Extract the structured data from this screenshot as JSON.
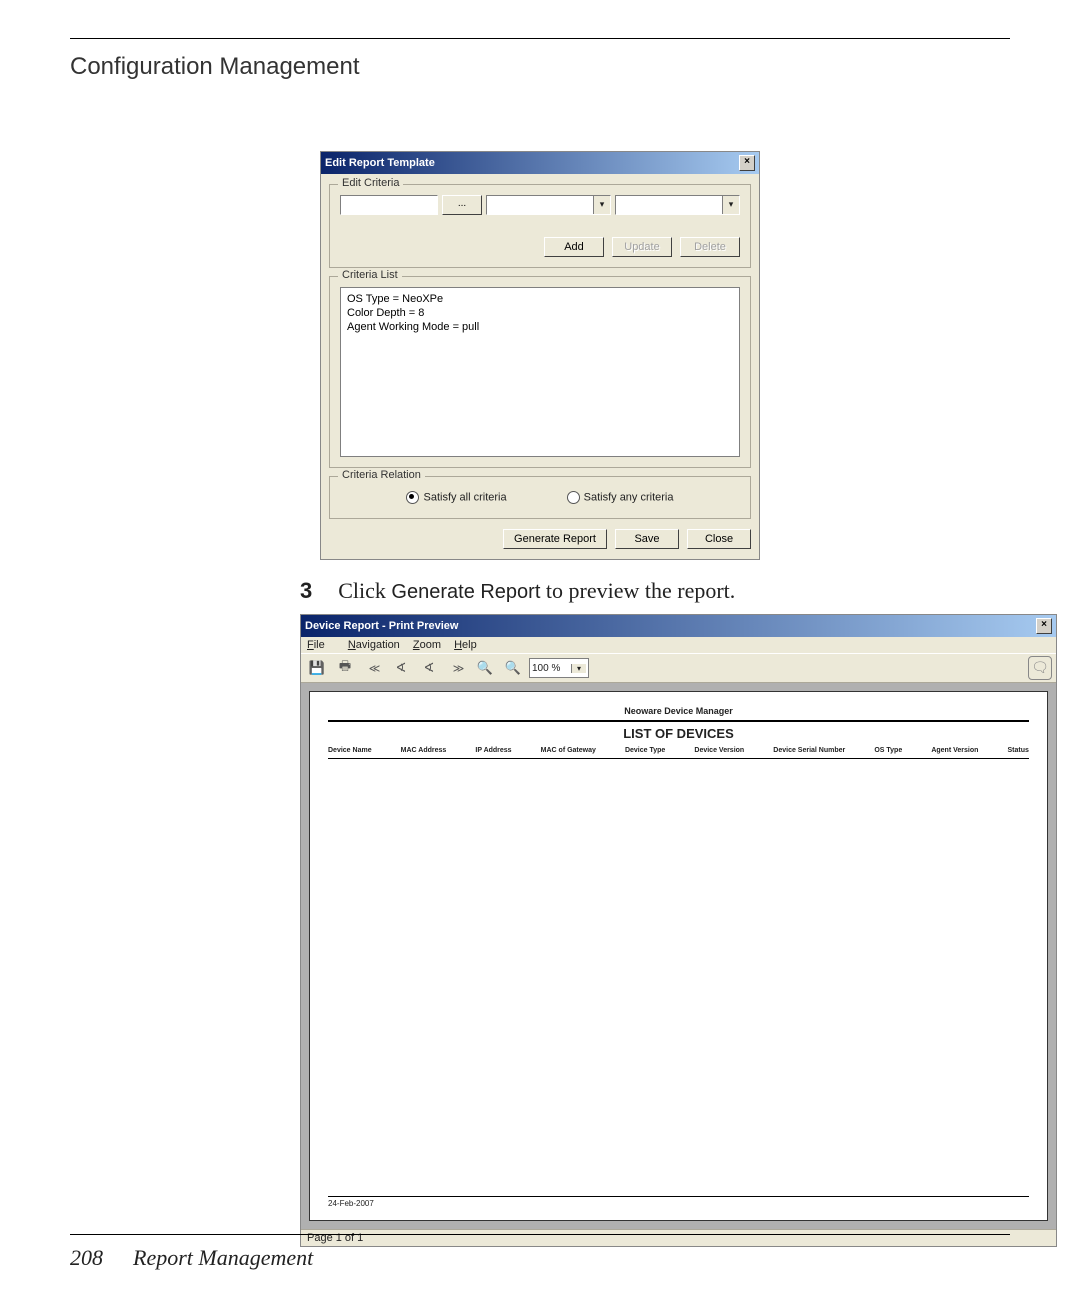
{
  "header": {
    "title": "Configuration Management"
  },
  "dialog1": {
    "window_title": "Edit Report Template",
    "edit_criteria": {
      "legend": "Edit Criteria",
      "field1_value": "",
      "browse_label": "...",
      "buttons": {
        "add": "Add",
        "update": "Update",
        "delete": "Delete"
      }
    },
    "criteria_list": {
      "legend": "Criteria List",
      "items": [
        "OS Type = NeoXPe",
        "Color Depth = 8",
        "Agent Working Mode = pull"
      ]
    },
    "relation": {
      "legend": "Criteria Relation",
      "opt_all": "Satisfy all criteria",
      "opt_any": "Satisfy any criteria",
      "selected": "all"
    },
    "actions": {
      "generate": "Generate Report",
      "save": "Save",
      "close": "Close"
    }
  },
  "step": {
    "number": "3",
    "pre": "Click ",
    "command": "Generate Report",
    "post": " to preview the report."
  },
  "dialog2": {
    "window_title": "Device Report - Print Preview",
    "menu": {
      "file": "File",
      "nav": "Navigation",
      "zoom": "Zoom",
      "help": "Help"
    },
    "zoom_value": "100 %",
    "report": {
      "brand": "Neoware Device Manager",
      "title": "LIST OF DEVICES",
      "columns": [
        "Device Name",
        "MAC Address",
        "IP Address",
        "MAC of Gateway",
        "Device Type",
        "Device Version",
        "Device Serial Number",
        "OS Type",
        "Agent Version",
        "Status"
      ],
      "footer_date": "24-Feb-2007"
    },
    "status": "Page 1 of 1"
  },
  "footer": {
    "page_number": "208",
    "section": "Report Management"
  }
}
